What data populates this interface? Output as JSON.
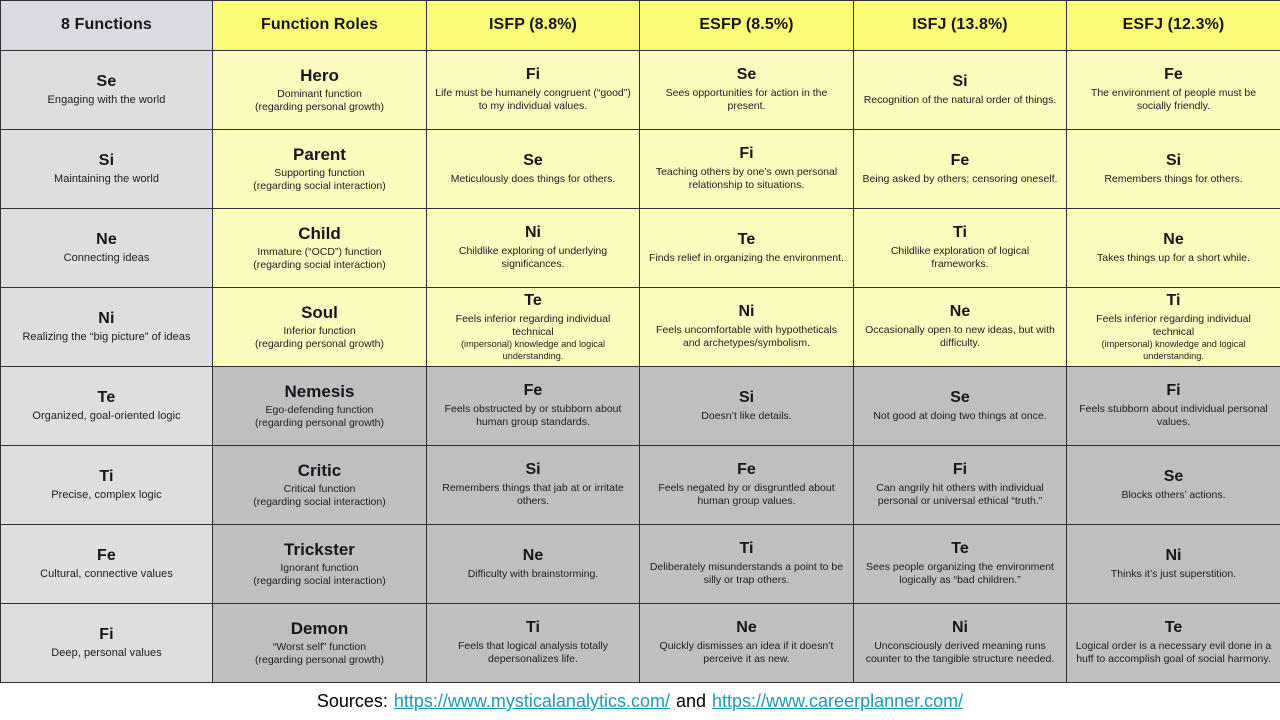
{
  "table": {
    "headers": [
      "8 Functions",
      "Function Roles",
      "ISFP (8.8%)",
      "ESFP (8.5%)",
      "ISFJ (13.8%)",
      "ESFJ (12.3%)"
    ],
    "rows": [
      {
        "function": {
          "code": "Se",
          "desc": "Engaging with the world"
        },
        "role": {
          "name": "Hero",
          "line1": "Dominant function",
          "line2": "(regarding personal growth)"
        },
        "types": [
          {
            "code": "Fi",
            "desc": "Life must be humanely congruent (“good”) to my individual values."
          },
          {
            "code": "Se",
            "desc": "Sees opportunities for action in the present."
          },
          {
            "code": "Si",
            "desc": "Recognition of the natural order of things."
          },
          {
            "code": "Fe",
            "desc": "The environment of people must be socially friendly."
          }
        ],
        "tone": "yellow"
      },
      {
        "function": {
          "code": "Si",
          "desc": "Maintaining the world"
        },
        "role": {
          "name": "Parent",
          "line1": "Supporting function",
          "line2": "(regarding social interaction)"
        },
        "types": [
          {
            "code": "Se",
            "desc": "Meticulously does things for others."
          },
          {
            "code": "Fi",
            "desc": "Teaching others by one’s own personal relationship to situations."
          },
          {
            "code": "Fe",
            "desc": "Being asked by others; censoring oneself."
          },
          {
            "code": "Si",
            "desc": "Remembers things for others."
          }
        ],
        "tone": "yellow"
      },
      {
        "function": {
          "code": "Ne",
          "desc": "Connecting ideas"
        },
        "role": {
          "name": "Child",
          "line1": "Immature (“OCD”) function",
          "line2": "(regarding social interaction)"
        },
        "types": [
          {
            "code": "Ni",
            "desc": "Childlike exploring of underlying significances."
          },
          {
            "code": "Te",
            "desc": "Finds relief in organizing the environment."
          },
          {
            "code": "Ti",
            "desc": "Childlike exploration of logical frameworks."
          },
          {
            "code": "Ne",
            "desc": "Takes things up for a short while."
          }
        ],
        "tone": "yellow"
      },
      {
        "function": {
          "code": "Ni",
          "desc": "Realizing the “big picture” of ideas"
        },
        "role": {
          "name": "Soul",
          "line1": "Inferior function",
          "line2": "(regarding personal growth)"
        },
        "types": [
          {
            "code": "Te",
            "desc": "Feels inferior regarding individual technical",
            "desc_small": "(impersonal) knowledge and logical understanding."
          },
          {
            "code": "Ni",
            "desc": "Feels uncomfortable with hypotheticals and archetypes/symbolism."
          },
          {
            "code": "Ne",
            "desc": "Occasionally open to new ideas, but with difficulty."
          },
          {
            "code": "Ti",
            "desc": "Feels inferior regarding individual technical",
            "desc_small": "(impersonal) knowledge and logical understanding."
          }
        ],
        "tone": "yellow"
      },
      {
        "function": {
          "code": "Te",
          "desc": "Organized, goal-oriented logic"
        },
        "role": {
          "name": "Nemesis",
          "line1": "Ego-defending function",
          "line2": "(regarding personal growth)"
        },
        "types": [
          {
            "code": "Fe",
            "desc": "Feels obstructed by or stubborn about human group standards."
          },
          {
            "code": "Si",
            "desc": "Doesn’t like details."
          },
          {
            "code": "Se",
            "desc": "Not good at doing two things at once."
          },
          {
            "code": "Fi",
            "desc": "Feels stubborn about individual personal values."
          }
        ],
        "tone": "gray"
      },
      {
        "function": {
          "code": "Ti",
          "desc": "Precise, complex logic"
        },
        "role": {
          "name": "Critic",
          "line1": "Critical function",
          "line2": "(regarding social interaction)"
        },
        "types": [
          {
            "code": "Si",
            "desc": "Remembers things that jab at or irritate others."
          },
          {
            "code": "Fe",
            "desc": "Feels negated by or disgruntled about human group values."
          },
          {
            "code": "Fi",
            "desc": "Can angrily hit others with individual personal or universal ethical “truth.”"
          },
          {
            "code": "Se",
            "desc": "Blocks others’ actions."
          }
        ],
        "tone": "gray"
      },
      {
        "function": {
          "code": "Fe",
          "desc": "Cultural, connective values"
        },
        "role": {
          "name": "Trickster",
          "line1": "Ignorant function",
          "line2": "(regarding social interaction)"
        },
        "types": [
          {
            "code": "Ne",
            "desc": "Difficulty with brainstorming."
          },
          {
            "code": "Ti",
            "desc": "Deliberately misunderstands a point to be silly or trap others."
          },
          {
            "code": "Te",
            "desc": "Sees people organizing the environment logically as “bad children.”"
          },
          {
            "code": "Ni",
            "desc": "Thinks it’s just superstition."
          }
        ],
        "tone": "gray"
      },
      {
        "function": {
          "code": "Fi",
          "desc": "Deep, personal values"
        },
        "role": {
          "name": "Demon",
          "line1": "“Worst self” function",
          "line2": "(regarding personal growth)"
        },
        "types": [
          {
            "code": "Ti",
            "desc": "Feels that logical analysis totally depersonalizes life."
          },
          {
            "code": "Ne",
            "desc": "Quickly dismisses an idea if it doesn’t perceive it as new."
          },
          {
            "code": "Ni",
            "desc": "Unconsciously derived meaning runs counter to the tangible structure needed."
          },
          {
            "code": "Te",
            "desc": "Logical order is a necessary evil done in a huff to accomplish goal of social harmony."
          }
        ],
        "tone": "gray"
      }
    ]
  },
  "footer": {
    "label": "Sources:",
    "link1": "https://www.mysticalanalytics.com/",
    "conjunction": "and",
    "link2": "https://www.careerplanner.com/"
  },
  "colors": {
    "header_gray": "#dadae2",
    "header_yellow": "#fbfb7a",
    "cell_yellow": "#fbfbbd",
    "cell_gray": "#bfbfbf",
    "function_column": "#dedede",
    "border": "#2f2f38",
    "link": "#1a9bb8"
  }
}
